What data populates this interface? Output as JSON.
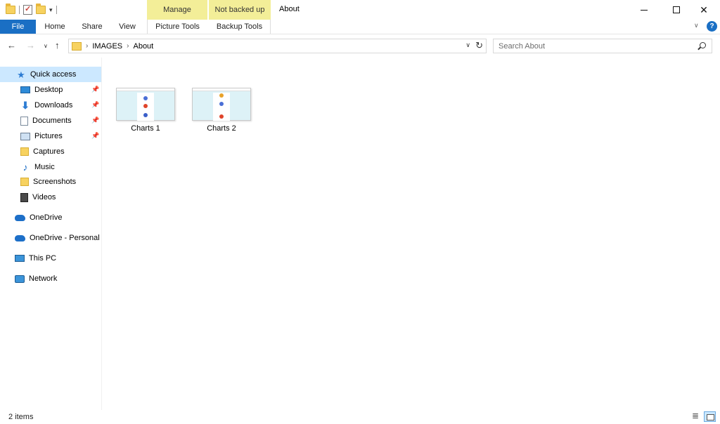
{
  "window": {
    "title": "About",
    "contextual_tabs": {
      "manage": "Manage",
      "not_backed_up": "Not backed up"
    }
  },
  "ribbon": {
    "tabs": {
      "file": "File",
      "home": "Home",
      "share": "Share",
      "view": "View",
      "picture_tools": "Picture Tools",
      "backup_tools": "Backup Tools"
    },
    "help": "?"
  },
  "address": {
    "breadcrumb": [
      "IMAGES",
      "About"
    ]
  },
  "search": {
    "placeholder": "Search About"
  },
  "nav": {
    "quick_access": "Quick access",
    "items": [
      {
        "label": "Desktop",
        "icon": "desktop-icon",
        "pinned": true
      },
      {
        "label": "Downloads",
        "icon": "downloads-icon",
        "pinned": true
      },
      {
        "label": "Documents",
        "icon": "documents-icon",
        "pinned": true
      },
      {
        "label": "Pictures",
        "icon": "pictures-icon",
        "pinned": true
      },
      {
        "label": "Captures",
        "icon": "folder-icon",
        "pinned": false
      },
      {
        "label": "Music",
        "icon": "music-icon",
        "pinned": false
      },
      {
        "label": "Screenshots",
        "icon": "folder-icon",
        "pinned": false
      },
      {
        "label": "Videos",
        "icon": "videos-icon",
        "pinned": false
      }
    ],
    "onedrive": "OneDrive",
    "onedrive_personal": "OneDrive - Personal",
    "this_pc": "This PC",
    "network": "Network"
  },
  "files": [
    {
      "name": "Charts 1",
      "thumb_dots": [
        "#4a6fd6",
        "#e0442a",
        "#3a5fc9"
      ]
    },
    {
      "name": "Charts 2",
      "thumb_dots": [
        "#e8a22a",
        "#4a6fd6",
        "#e0442a"
      ]
    }
  ],
  "status": {
    "item_count": "2 items"
  },
  "colors": {
    "accent": "#1a6fc4",
    "contextual_tab": "#f3ee98",
    "selection": "#cce8ff"
  }
}
